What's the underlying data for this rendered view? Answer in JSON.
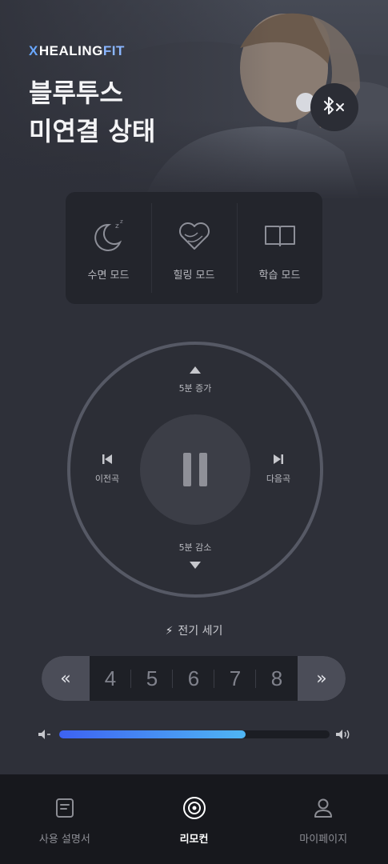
{
  "brand": {
    "logo_x": "X",
    "logo_main": "HEALING",
    "logo_fit": "FIT"
  },
  "header": {
    "title_line1": "블루투스",
    "title_line2": "미연결 상태",
    "bluetooth_icon": "bluetooth-disconnected-icon"
  },
  "modes": [
    {
      "label": "수면 모드",
      "icon": "moon-sleep-icon"
    },
    {
      "label": "힐링 모드",
      "icon": "heart-icon"
    },
    {
      "label": "학습 모드",
      "icon": "book-icon"
    }
  ],
  "dial": {
    "up_label": "5분 증가",
    "down_label": "5분 감소",
    "prev_label": "이전곡",
    "next_label": "다음곡",
    "center_icon": "pause-icon"
  },
  "power": {
    "label": "전기 세기",
    "icon": "lightning-icon"
  },
  "stepper": {
    "prev": "«",
    "next": "»",
    "values": [
      "4",
      "5",
      "6",
      "7",
      "8"
    ]
  },
  "volume": {
    "level": 0.69
  },
  "nav": {
    "items": [
      {
        "label": "사용 설명서",
        "icon": "manual-icon"
      },
      {
        "label": "리모컨",
        "icon": "remote-icon",
        "active": true
      },
      {
        "label": "마이페이지",
        "icon": "user-icon"
      }
    ]
  },
  "colors": {
    "background": "#2e3039",
    "accent_start": "#3d62f2",
    "accent_end": "#4fb6f4",
    "nav_background": "#17181d"
  }
}
